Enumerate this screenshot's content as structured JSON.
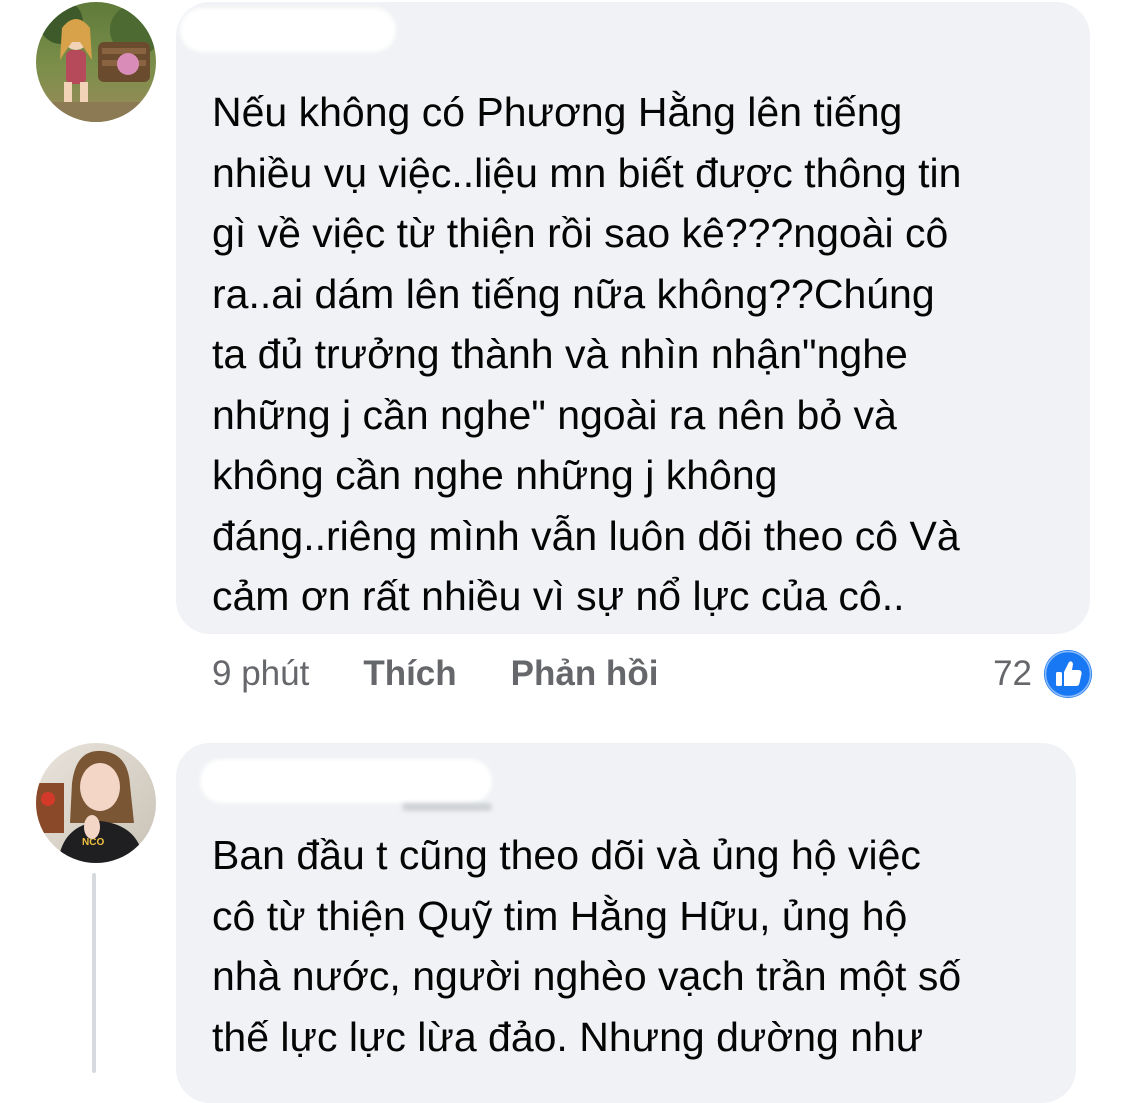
{
  "colors": {
    "bubble": "#f0f2f5",
    "text": "#050505",
    "secondary_text": "#65676b",
    "like_blue": "#1877f2",
    "thread_line": "#d6d9de"
  },
  "comments": [
    {
      "author": "",
      "avatar_icon": "user-avatar-icon",
      "text": "Nếu không có  Phương Hằng lên tiếng\nnhiều vụ việc..liệu mn biết được thông tin\ngì về việc từ thiện rồi sao kê???ngoài cô\nra..ai dám lên tiếng nữa không??Chúng\nta đủ trưởng thành và nhìn nhận\"nghe\nnhững j cần nghe\" ngoài ra nên bỏ và\nkhông cần nghe những j không\nđáng..riêng mình vẫn luôn dõi theo cô Và\ncảm ơn rất nhiều vì sự nổ lực của cô..",
      "timestamp": "9 phút",
      "like_label": "Thích",
      "reply_label": "Phản hồi",
      "reaction_count": "72",
      "reaction_icon": "like-reaction-icon"
    },
    {
      "author": "",
      "avatar_icon": "user-avatar-icon",
      "text": "Ban đầu t cũng theo dõi và ủng hộ việc\ncô từ thiện Quỹ tim Hằng Hữu, ủng hộ\nnhà nước, người nghèo vạch trần một số\nthế lực lực lừa đảo. Nhưng dường như"
    }
  ]
}
